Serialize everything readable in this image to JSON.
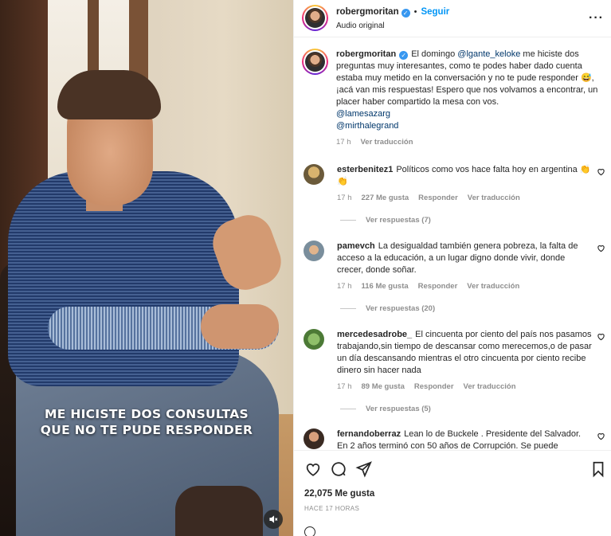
{
  "video": {
    "caption_line1": "ME HICISTE DOS CONSULTAS",
    "caption_line2": "QUE NO TE PUDE RESPONDER"
  },
  "header": {
    "username": "robergmoritan",
    "follow_label": "Seguir",
    "dot": "•",
    "subtitle": "Audio original",
    "more": "···"
  },
  "caption": {
    "username": "robergmoritan",
    "text_a": "El domingo ",
    "mention1": "@lgante_keloke",
    "text_b": " me hiciste dos preguntas muy interesantes, como te podes haber dado cuenta estaba muy metido en la conversación y no te pude responder 😅, ¡acá van mis respuestas! Espero que nos volvamos a encontrar, un placer haber compartido la mesa con vos.",
    "mention2": "@lamesazarg",
    "mention3": "@mirthalegrand",
    "time": "17 h",
    "translate": "Ver traducción"
  },
  "comments": [
    {
      "username": "esterbenitez1",
      "text": "Políticos como vos hace falta hoy en argentina 👏👏",
      "time": "17 h",
      "likes": "227 Me gusta",
      "reply": "Responder",
      "translate": "Ver traducción",
      "replies": "Ver respuestas (7)"
    },
    {
      "username": "pamevch",
      "text": "La desigualdad también genera pobreza, la falta de acceso a la educación, a un lugar digno donde vivir, donde crecer, donde soñar.",
      "time": "17 h",
      "likes": "116 Me gusta",
      "reply": "Responder",
      "translate": "Ver traducción",
      "replies": "Ver respuestas (20)"
    },
    {
      "username": "mercedesadrobe_",
      "text": "El cincuenta por ciento del país nos pasamos trabajando,sin tiempo de descansar como merecemos,o de pasar un día descansando mientras el otro cincuenta por ciento recibe dinero sin hacer nada",
      "time": "17 h",
      "likes": "89 Me gusta",
      "reply": "Responder",
      "translate": "Ver traducción",
      "replies": "Ver respuestas (5)"
    },
    {
      "username": "fernandoberraz",
      "text": "Lean lo de Buckele . Presidente del Salvador. En 2 años terminó con 50 años de Corrupción. Se puede"
    }
  ],
  "footer": {
    "likes": "22,075 Me gusta",
    "time": "HACE 17 HORAS"
  },
  "icons": {
    "heart": "heart-icon",
    "comment": "comment-icon",
    "share": "share-icon",
    "bookmark": "bookmark-icon",
    "mute": "mute-icon",
    "verified": "verified-icon"
  },
  "colors": {
    "link": "#0095f6",
    "mention": "#00376b",
    "verified": "#3797f0",
    "muted_text": "#8e8e8e"
  }
}
